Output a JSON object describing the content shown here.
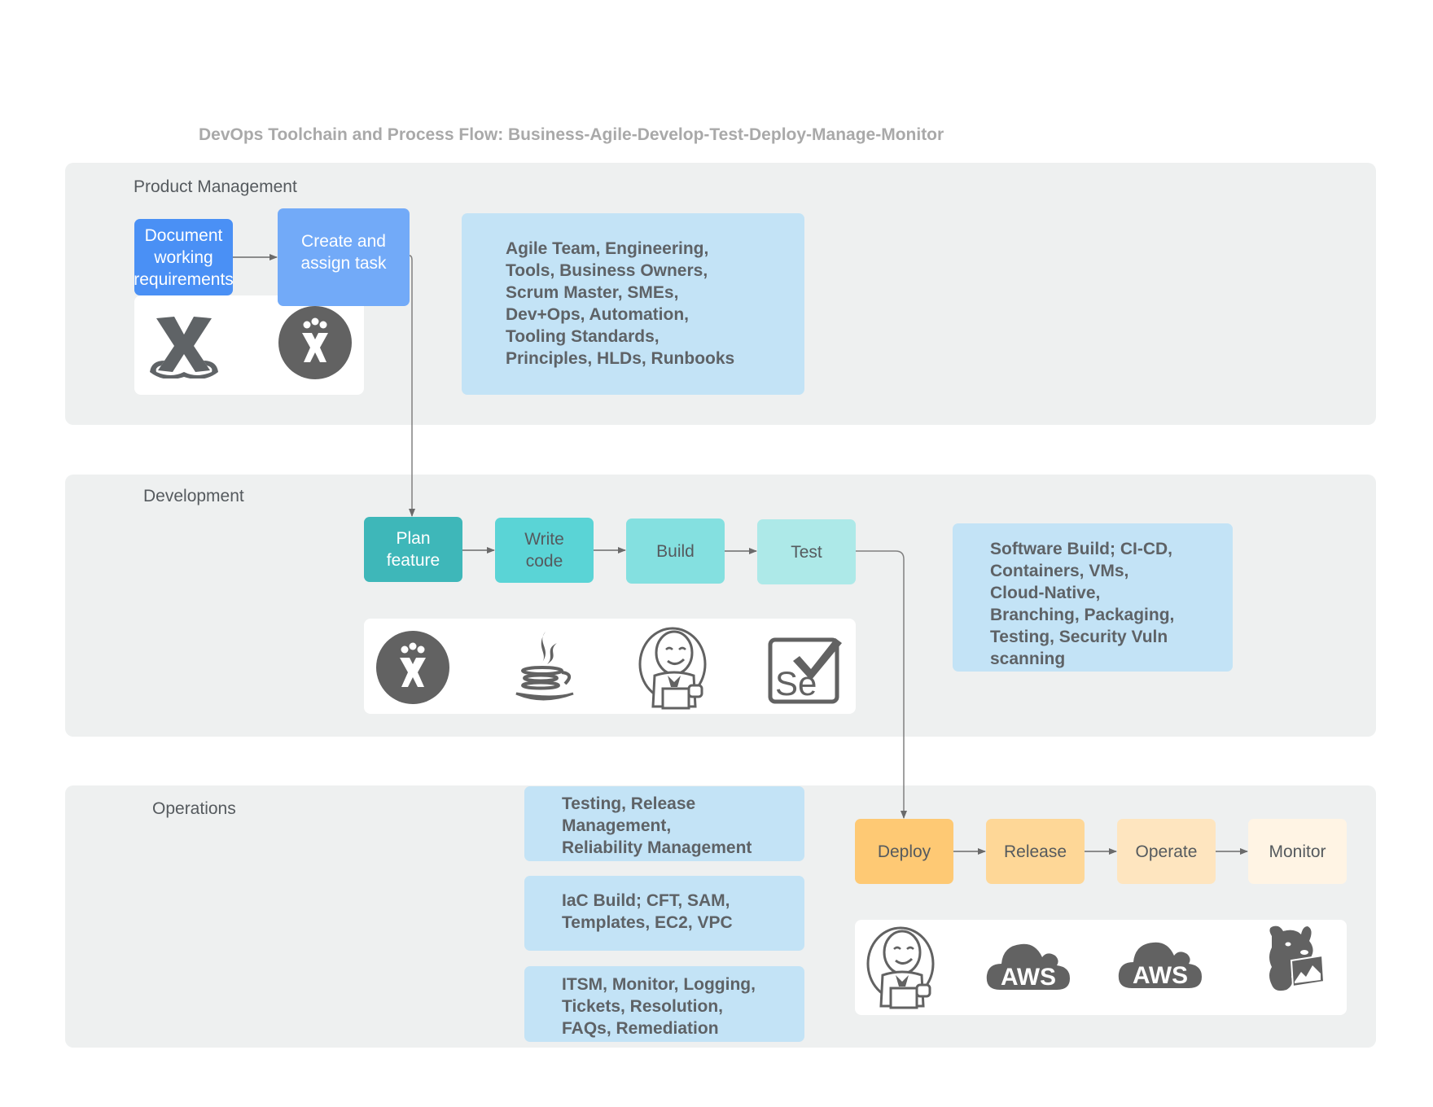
{
  "title": "DevOps Toolchain and Process Flow: Business-Agile-Develop-Test-Deploy-Manage-Monitor",
  "lanes": [
    {
      "label": "Product Management",
      "steps": [
        {
          "label": "Document\nworking\nrequirements",
          "color": "#4a90f5",
          "text_color": "#ffffff"
        },
        {
          "label": "Create and\nassign task",
          "color": "#72aaf8",
          "text_color": "#ffffff"
        }
      ],
      "info": "Agile Team, Engineering,\nTools, Business Owners,\nScrum Master, SMEs,\nDev+Ops, Automation,\nTooling Standards,\nPrinciples, HLDs, Runbooks",
      "tools": [
        "confluence-icon",
        "jira-icon"
      ]
    },
    {
      "label": "Development",
      "steps": [
        {
          "label": "Plan\nfeature",
          "color": "#3eb7b9",
          "text_color": "#ffffff"
        },
        {
          "label": "Write\ncode",
          "color": "#5ad4d6",
          "text_color": "#555a5e"
        },
        {
          "label": "Build",
          "color": "#84e0e0",
          "text_color": "#555a5e"
        },
        {
          "label": "Test",
          "color": "#ade9e8",
          "text_color": "#555a5e"
        }
      ],
      "info": "Software Build; CI-CD,\nContainers, VMs,\nCloud-Native,\nBranching, Packaging,\nTesting, Security Vuln\nscanning",
      "tools": [
        "jira-icon",
        "java-icon",
        "jenkins-icon",
        "selenium-icon"
      ]
    },
    {
      "label": "Operations",
      "steps": [
        {
          "label": "Deploy",
          "color": "#fec974",
          "text_color": "#555a5e"
        },
        {
          "label": "Release",
          "color": "#fed797",
          "text_color": "#555a5e"
        },
        {
          "label": "Operate",
          "color": "#fee5bf",
          "text_color": "#555a5e"
        },
        {
          "label": "Monitor",
          "color": "#fff4e4",
          "text_color": "#555a5e"
        }
      ],
      "info_boxes": [
        "Testing, Release\nManagement,\nReliability Management",
        "IaC Build; CFT, SAM,\nTemplates, EC2, VPC",
        "ITSM, Monitor, Logging,\nTickets, Resolution,\nFAQs, Remediation"
      ],
      "tools": [
        "jenkins-icon",
        "aws-icon",
        "aws-icon",
        "datadog-icon"
      ],
      "aws_text": "AWS",
      "selenium_text": "Se"
    }
  ]
}
